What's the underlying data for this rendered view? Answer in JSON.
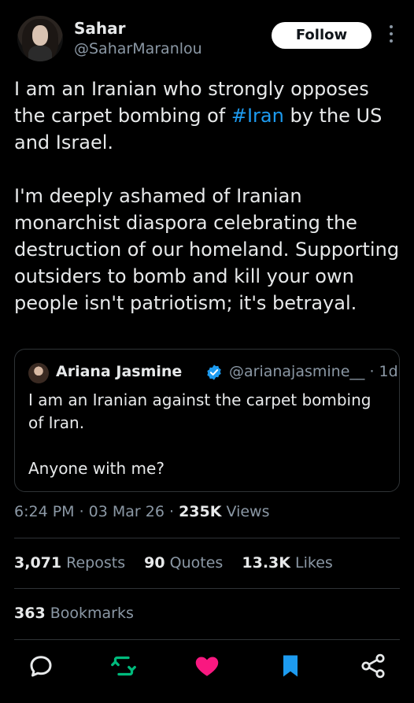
{
  "author": {
    "display_name": "Sahar",
    "handle": "@SaharMaranlou"
  },
  "follow_button": {
    "label": "Follow"
  },
  "tweet": {
    "paragraph1_before": "I am an Iranian who strongly opposes the carpet bombing of ",
    "hashtag": "#Iran",
    "paragraph1_after": " by the US and Israel.",
    "paragraph2": "I'm  deeply ashamed of Iranian monarchist diaspora celebrating the destruction of our homeland. Supporting outsiders to bomb and kill your own people isn't patriotism; it's betrayal."
  },
  "quoted_tweet": {
    "display_name": "Ariana Jasmine",
    "handle_time": "@arianajasmine__ · 1d",
    "text_line1": "I am an Iranian against the carpet bombing of Iran.",
    "text_line2": "Anyone with me?"
  },
  "meta": {
    "time_date": "6:24 PM · 03 Mar 26 · ",
    "views_count": "235K",
    "views_label": " Views"
  },
  "stats": {
    "reposts_count": "3,071",
    "reposts_label": " Reposts",
    "quotes_count": "90",
    "quotes_label": " Quotes",
    "likes_count": "13.3K",
    "likes_label": " Likes",
    "bookmarks_count": "363",
    "bookmarks_label": " Bookmarks"
  },
  "actions": {
    "reply_icon": "speech-bubble-icon",
    "repost_icon": "repost-arrows-icon",
    "like_icon": "heart-icon",
    "bookmark_icon": "bookmark-icon",
    "share_icon": "share-nodes-icon"
  },
  "colors": {
    "background": "#000000",
    "text": "#e7e9ea",
    "secondary": "#8b98a5",
    "link": "#1d9bf0",
    "repost_active": "#00ba7c",
    "like_active": "#f91880",
    "bookmark_active": "#1d9bf0",
    "divider": "#2f3336"
  }
}
